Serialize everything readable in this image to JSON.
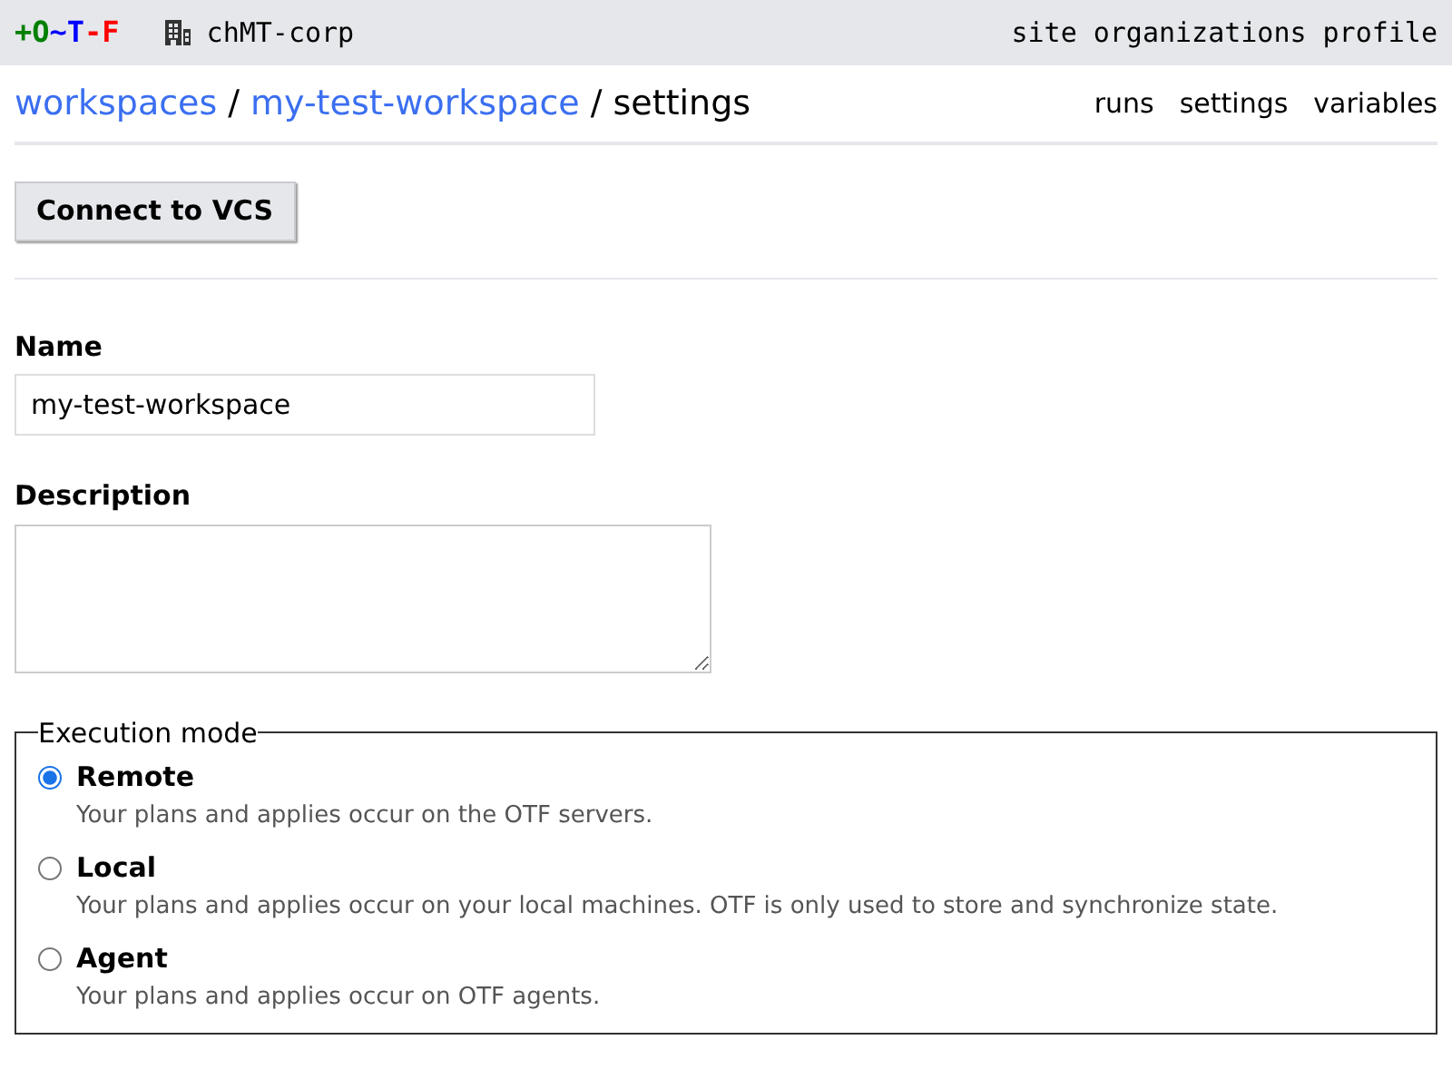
{
  "top_bar": {
    "logo": [
      {
        "text": "+O",
        "color": "#008000"
      },
      {
        "text": "~T",
        "color": "#0000ff"
      },
      {
        "text": "-F",
        "color": "#ff0000"
      }
    ],
    "organization": "chMT-corp",
    "links": [
      "site",
      "organizations",
      "profile"
    ]
  },
  "breadcrumbs": [
    {
      "kind": "link",
      "text": "workspaces"
    },
    {
      "kind": "separator",
      "text": "/"
    },
    {
      "kind": "link",
      "text": "my-test-workspace"
    },
    {
      "kind": "separator",
      "text": "/"
    },
    {
      "kind": "current",
      "text": "settings"
    }
  ],
  "sub_nav": [
    "runs",
    "settings",
    "variables"
  ],
  "connect_button": "Connect to VCS",
  "name_field": {
    "label": "Name",
    "value": "my-test-workspace"
  },
  "description_field": {
    "label": "Description"
  },
  "execution_mode": {
    "legend": "Execution mode",
    "options": [
      {
        "label": "Remote",
        "description": "Your plans and applies occur on the OTF servers.",
        "selected": true
      },
      {
        "label": "Local",
        "description": "Your plans and applies occur on your local machines. OTF is only used to store and synchronize state.",
        "selected": false
      },
      {
        "label": "Agent",
        "description": "Your plans and applies occur on OTF agents.",
        "selected": false
      }
    ]
  }
}
